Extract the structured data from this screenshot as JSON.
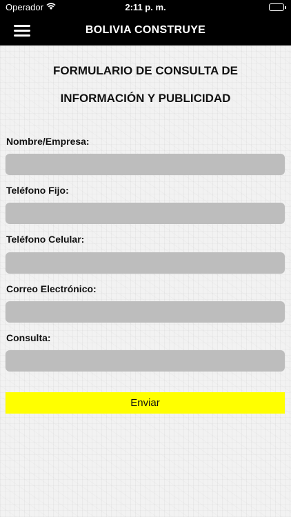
{
  "status_bar": {
    "carrier": "Operador",
    "time": "2:11 p. m."
  },
  "nav": {
    "title": "BOLIVIA CONSTRUYE"
  },
  "form": {
    "title_line1": "FORMULARIO DE CONSULTA DE",
    "title_line2": "INFORMACIÓN Y PUBLICIDAD",
    "fields": [
      {
        "label": "Nombre/Empresa:",
        "value": ""
      },
      {
        "label": "Teléfono Fijo:",
        "value": ""
      },
      {
        "label": "Teléfono Celular:",
        "value": ""
      },
      {
        "label": "Correo Electrónico:",
        "value": ""
      },
      {
        "label": "Consulta:",
        "value": ""
      }
    ],
    "submit_label": "Enviar",
    "submit_color": "#ffff00"
  }
}
